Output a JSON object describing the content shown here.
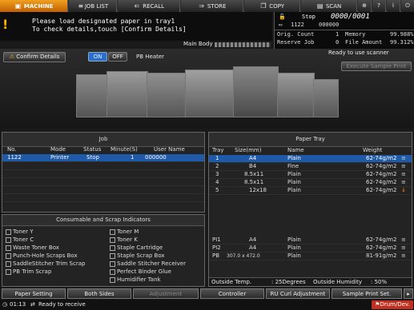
{
  "tabs": [
    {
      "label": "MACHINE",
      "icon": "printer-icon",
      "active": true
    },
    {
      "label": "JOB LIST",
      "icon": "list-icon",
      "active": false
    },
    {
      "label": "RECALL",
      "icon": "recall-icon",
      "active": false
    },
    {
      "label": "STORE",
      "icon": "store-icon",
      "active": false
    },
    {
      "label": "COPY",
      "icon": "copy-icon",
      "active": false
    },
    {
      "label": "SCAN",
      "icon": "scan-icon",
      "active": false
    }
  ],
  "message": {
    "line1": "Please load designated paper in tray1",
    "line2": "To check details,touch [Confirm Details]"
  },
  "status": {
    "state": "Stop",
    "counter": "0000/0001",
    "job_id": "1122",
    "job_no": "000000",
    "orig_count_label": "Orig. Count",
    "orig_count": "1",
    "memory_label": "Memory",
    "memory": "99.988%",
    "reserve_label": "Reserve Job",
    "reserve": "0",
    "file_label": "File Amount",
    "file": "99.312%",
    "scanner_status": "Ready to use scanner"
  },
  "main_body_label": "Main Body",
  "confirm_details": "Confirm Details",
  "pb_heater": {
    "on": "ON",
    "off": "OFF",
    "label": "PB Heater"
  },
  "execute_sample": "Execute Sample Print",
  "job_panel": {
    "title": "Job",
    "headers": [
      "No.",
      "Mode",
      "Status",
      "Minute(S)",
      "User Name"
    ],
    "rows": [
      {
        "no": "1122",
        "mode": "Printer",
        "status": "Stop",
        "minute": "1",
        "user": "000000"
      }
    ]
  },
  "consumables": {
    "title": "Consumable and Scrap Indicators",
    "left": [
      "Toner Y",
      "Toner C",
      "Waste Toner Box",
      "Punch-Hole Scraps Box",
      "SaddleStitcher Trim Scrap",
      "PB Trim Scrap"
    ],
    "right": [
      "Toner M",
      "Toner K",
      "Staple Cartridge",
      "Staple Scrap Box",
      "Saddle Stitcher Receiver",
      "Perfect Binder Glue",
      "Humidifier Tank"
    ]
  },
  "paper_tray": {
    "title": "Paper Tray",
    "headers": [
      "Tray",
      "Size(mm)",
      "Name",
      "Weight"
    ],
    "rows": [
      {
        "tray": "1",
        "size": "A4",
        "name": "Plain",
        "weight": "62-74g/m2"
      },
      {
        "tray": "2",
        "size": "B4",
        "name": "Fine",
        "weight": "62-74g/m2"
      },
      {
        "tray": "3",
        "size": "8.5x11",
        "name": "Plain",
        "weight": "62-74g/m2"
      },
      {
        "tray": "4",
        "size": "8.5x11",
        "name": "Plain",
        "weight": "62-74g/m2"
      },
      {
        "tray": "5",
        "size": "12x18",
        "name": "Plain",
        "weight": "62-74g/m2"
      }
    ],
    "extra_rows": [
      {
        "tray": "PI1",
        "size": "A4",
        "name": "Plain",
        "weight": "62-74g/m2"
      },
      {
        "tray": "PI2",
        "size": "A4",
        "name": "Plain",
        "weight": "62-74g/m2"
      },
      {
        "tray": "PB",
        "size": "307.0 x 472.0",
        "name": "Plain",
        "weight": "81-91g/m2"
      }
    ],
    "outside_temp_label": "Outside Temp.",
    "outside_temp": ": 25Degrees",
    "outside_hum_label": "Outside Humidity",
    "outside_hum": ": 50%"
  },
  "bottom_buttons": [
    "Paper Setting",
    "Both Sides",
    "Adjustment",
    "Controller",
    "RU Curl Adjustment",
    "Sample Print Set."
  ],
  "footer": {
    "time": "01:13",
    "status": "Ready to receive",
    "drum": "Drum/Dev."
  },
  "colors": {
    "accent": "#e07a10",
    "selected_row": "#1e5aa8",
    "on_button": "#2a6fd0"
  }
}
